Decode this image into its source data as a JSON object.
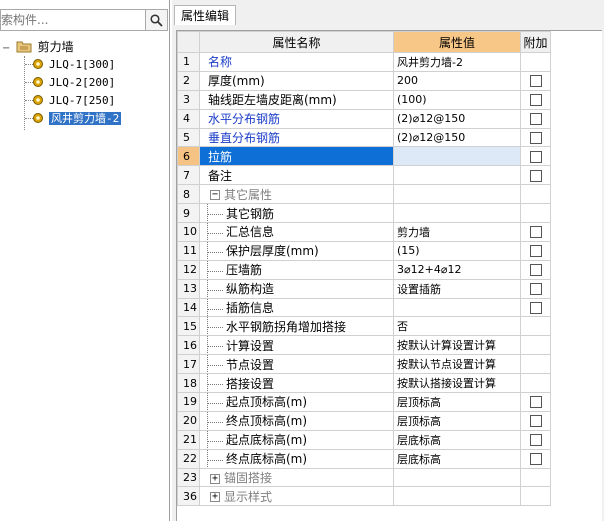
{
  "search": {
    "placeholder": "搜索构件..."
  },
  "tree": {
    "root_label": "剪力墙",
    "root_expander": "−",
    "children": [
      {
        "label": "JLQ-1[300]"
      },
      {
        "label": "JLQ-2[200]"
      },
      {
        "label": "JLQ-7[250]"
      },
      {
        "label": "风井剪力墙-2",
        "selected": true
      }
    ]
  },
  "panel": {
    "tab_label": "属性编辑"
  },
  "grid": {
    "headers": {
      "name": "属性名称",
      "value": "属性值",
      "extra": "附加"
    },
    "rows": [
      {
        "num": "1",
        "name": "名称",
        "value": "风井剪力墙-2",
        "checkbox": false,
        "style": "blue"
      },
      {
        "num": "2",
        "name": "厚度(mm)",
        "value": "200",
        "checkbox": true
      },
      {
        "num": "3",
        "name": "轴线距左墙皮距离(mm)",
        "value": "(100)",
        "checkbox": true
      },
      {
        "num": "4",
        "name": "水平分布钢筋",
        "value": "(2)⌀12@150",
        "checkbox": true,
        "style": "blue"
      },
      {
        "num": "5",
        "name": "垂直分布钢筋",
        "value": "(2)⌀12@150",
        "checkbox": true,
        "style": "blue"
      },
      {
        "num": "6",
        "name": "拉筋",
        "value": "",
        "checkbox": true,
        "selected": true
      },
      {
        "num": "7",
        "name": "备注",
        "value": "",
        "checkbox": true
      },
      {
        "num": "8",
        "name": "其它属性",
        "value": "",
        "checkbox": false,
        "style": "group",
        "expander": "−"
      },
      {
        "num": "9",
        "name": "其它钢筋",
        "value": "",
        "checkbox": false,
        "style": "child"
      },
      {
        "num": "10",
        "name": "汇总信息",
        "value": "剪力墙",
        "checkbox": true,
        "style": "child"
      },
      {
        "num": "11",
        "name": "保护层厚度(mm)",
        "value": "(15)",
        "checkbox": true,
        "style": "child"
      },
      {
        "num": "12",
        "name": "压墙筋",
        "value": "3⌀12+4⌀12",
        "checkbox": true,
        "style": "child"
      },
      {
        "num": "13",
        "name": "纵筋构造",
        "value": "设置插筋",
        "checkbox": true,
        "style": "child"
      },
      {
        "num": "14",
        "name": "插筋信息",
        "value": "",
        "checkbox": true,
        "style": "child"
      },
      {
        "num": "15",
        "name": "水平钢筋拐角增加搭接",
        "value": "否",
        "checkbox": false,
        "style": "child"
      },
      {
        "num": "16",
        "name": "计算设置",
        "value": "按默认计算设置计算",
        "checkbox": false,
        "style": "child"
      },
      {
        "num": "17",
        "name": "节点设置",
        "value": "按默认节点设置计算",
        "checkbox": false,
        "style": "child"
      },
      {
        "num": "18",
        "name": "搭接设置",
        "value": "按默认搭接设置计算",
        "checkbox": false,
        "style": "child"
      },
      {
        "num": "19",
        "name": "起点顶标高(m)",
        "value": "层顶标高",
        "checkbox": true,
        "style": "child"
      },
      {
        "num": "20",
        "name": "终点顶标高(m)",
        "value": "层顶标高",
        "checkbox": true,
        "style": "child"
      },
      {
        "num": "21",
        "name": "起点底标高(m)",
        "value": "层底标高",
        "checkbox": true,
        "style": "child"
      },
      {
        "num": "22",
        "name": "终点底标高(m)",
        "value": "层底标高",
        "checkbox": true,
        "style": "child"
      },
      {
        "num": "23",
        "name": "锚固搭接",
        "value": "",
        "checkbox": false,
        "style": "group",
        "expander": "+"
      },
      {
        "num": "36",
        "name": "显示样式",
        "value": "",
        "checkbox": false,
        "style": "group",
        "expander": "+"
      }
    ]
  },
  "colors": {
    "header_value_bg": "#f7c787",
    "selection_blue": "#0e6fd6",
    "label_blue": "#1a3cc8"
  }
}
